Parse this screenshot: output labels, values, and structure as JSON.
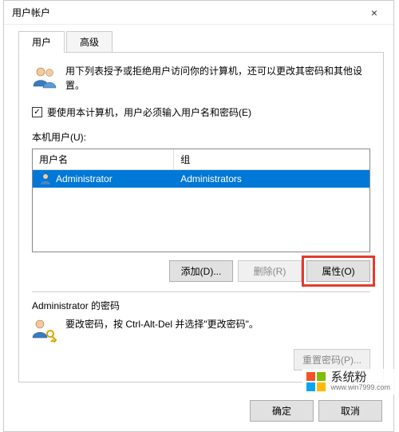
{
  "window": {
    "title": "用户帐户",
    "close_label": "×"
  },
  "tabs": {
    "user": "用户",
    "advanced": "高级"
  },
  "intro": {
    "text": "用下列表授予或拒绝用户访问你的计算机，还可以更改其密码和其他设置。"
  },
  "checkbox": {
    "label": "要使用本计算机，用户必须输入用户名和密码(E)",
    "checked": true
  },
  "user_list": {
    "heading": "本机用户(U):",
    "col_username": "用户名",
    "col_group": "组",
    "rows": [
      {
        "name": "Administrator",
        "group": "Administrators"
      }
    ]
  },
  "buttons": {
    "add": "添加(D)...",
    "remove": "删除(R)",
    "properties": "属性(O)"
  },
  "password_section": {
    "heading": "Administrator 的密码",
    "text": "要改密码，按 Ctrl-Alt-Del 并选择\"更改密码\"。",
    "reset": "重置密码(P)..."
  },
  "dialog_buttons": {
    "ok": "确定",
    "cancel": "取消"
  },
  "watermark": {
    "title": "系统粉",
    "sub": "www.win7999.com"
  }
}
